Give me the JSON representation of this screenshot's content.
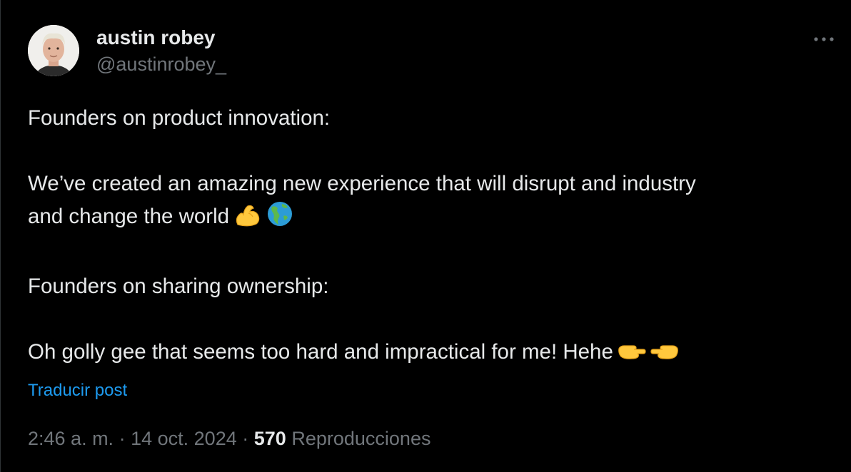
{
  "author": {
    "display_name": "austin robey",
    "handle": "@austinrobey_"
  },
  "tweet": {
    "lines": [
      "Founders on product innovation:",
      "",
      "We’ve created an amazing new experience that will disrupt and industry",
      "and change the world",
      "",
      "Founders on sharing ownership:",
      "",
      "Oh golly gee that seems too hard and impractical for me! Hehe"
    ],
    "emojis": [
      "flexed-biceps",
      "globe-americas",
      "pointing-right",
      "pointing-left"
    ]
  },
  "translate_label": "Traducir post",
  "meta": {
    "time": "2:46 a. m.",
    "separator": "·",
    "date": "14 oct. 2024",
    "views_count": "570",
    "views_label": "Reproducciones"
  },
  "colors": {
    "background": "#000000",
    "text": "#e7e9ea",
    "secondary": "#71767b",
    "link": "#1d9bf0"
  }
}
